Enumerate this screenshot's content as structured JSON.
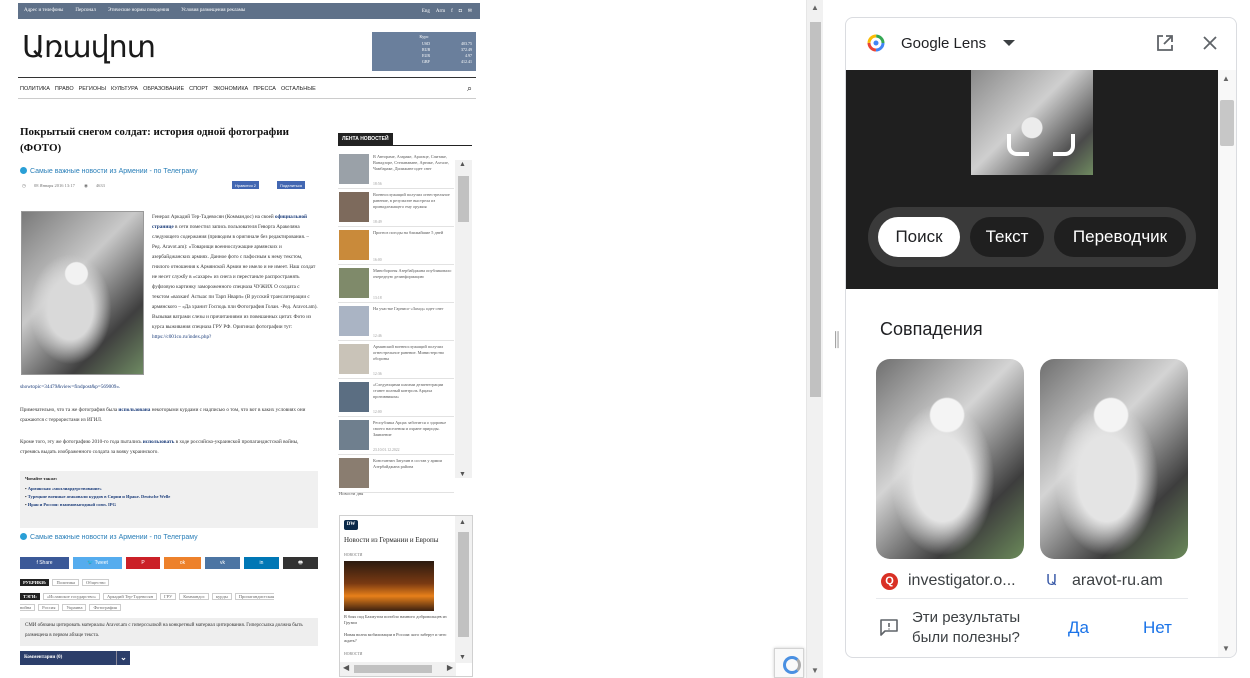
{
  "site": {
    "topbar_left": [
      "Адрес и телефоны",
      "Персонал",
      "Этические нормы поведения",
      "Условия размещения рекламы"
    ],
    "topbar_right": [
      "Eng",
      "Arm",
      "f",
      "◘",
      "✉"
    ],
    "logo": "Առավոտ",
    "rates": {
      "header": "Курс",
      "rows": [
        {
          "cur": "USD",
          "val": "403.75"
        },
        {
          "cur": "RUB",
          "val": "372.49"
        },
        {
          "cur": "EUR",
          "val": "4.97"
        },
        {
          "cur": "GBP",
          "val": "412.41"
        }
      ]
    },
    "nav": [
      "ПОЛИТИКА",
      "ПРАВО",
      "РЕГИОНЫ",
      "КУЛЬТУРА",
      "ОБРАЗОВАНИЕ",
      "СПОРТ",
      "ЭКОНОМИКА",
      "ПРЕССА",
      "ОСТАЛЬНЫЕ"
    ]
  },
  "article": {
    "title": "Покрытый снегом солдат: история одной фотографии (ФОТО)",
    "telegram": "Самые важные новости из Армении - по Телеграму",
    "date": "08 Января 2016 13:17",
    "views": "4633",
    "fb_like": "Нравится 2",
    "fb_share": "Поделиться",
    "p1_a": "Генерал Аркадий Тер-Тадевосян (Коммандос) на своей",
    "p1_link": "официальной странице",
    "p1_b": "в сети поместил запись пользователя Геворга Аракеляна следующего содержания (приводим в оригинале без редактирования. – Ред. Aravot.am): «Товарищи военнослужащие армянских и азербайджанских армиях. Данное фото с пафосным к нему текстом, гнилого отношения к Армянской Армии не имело и не имеет. Наш солдат не несет службу в «сахаре» из снега и перестаньте распространять фуфловую картинку замороженного спецназа ЧУЖИХ О солдата с текстом «вахкан! Астыас пи Тарп Нварп» (В русский транслитерации с армянского – «Да хранит Господь пли Фотография Голан. -Ред. Aravot.am). Вызывая ватрами слезы и причитаниями из повешанных цитат. Фото из курса выживания спецназа ГРУ РФ. Оригинал фотографии тут:",
    "p1_url": "https://c001co.ru/index.php?",
    "p1_tail": "showtopic=34479&view=findpost&p=569009».",
    "p2_a": "Примечательно, что та же фотография была",
    "p2_link": "использована",
    "p2_b": "некоторыми курдами с надписью о том, что вот в каких условиях они сражаются с террористами из ИГИЛ.",
    "p3_a": "Кроме того, эту же фотографию 2010-го года пытались",
    "p3_link": "использовать",
    "p3_b": "в ходе российско-украинской пропагандистской войны, стремясь выдать изображенного солдата за вояку украинского.",
    "read_also": {
      "heading": "Читайте также:",
      "items": [
        "Армянская «миллиардерствование»",
        "Турецкие военные атаковали курдов в Сирии и Ираке. Deutsche Welle",
        "Иран и Россия: взаимовыгодный союз. IPG"
      ]
    },
    "share": [
      "f  Share",
      "🐦  Tweet",
      "P",
      "ok",
      "vk",
      "in",
      "🖶"
    ],
    "rubrics_label": "РУБРИКИ:",
    "rubrics": [
      "Политика",
      "Общество"
    ],
    "tags_label": "ТЭГИ:",
    "tags": [
      "«Исламское государство»",
      "Аркадий Тер-Тадевосян",
      "ГРУ",
      "Коммандос",
      "курды",
      "Пропагандистская война",
      "Россия",
      "Украина",
      "Фотография"
    ],
    "notice": "СМИ обязаны цитировать материалы Aravot.am с гиперссылкой на конкретный материал цитирования. Гиперссылка должна быть размещена в первом абзаце текста.",
    "comments": "Комментарии (0)"
  },
  "feed": {
    "heading": "ЛЕНТА НОВОСТЕЙ",
    "items": [
      {
        "text": "В Автораме, Азараке, Арагаце, Спитаке, Ванадзоре, Степанаване, Артике, Ахтале, Чамбараке, Дилижане идет снег",
        "time": "18:56"
      },
      {
        "text": "Военнослужащий получил огнестрельное ранение, в результате выстрела из принадлежащего ему оружия",
        "time": "18:49"
      },
      {
        "text": "Прогноз погоды на ближайшие 5 дней",
        "time": "16:00"
      },
      {
        "text": "Минобороны Азербайджана опубликовало очередную дезинформацию",
        "time": "13:18"
      },
      {
        "text": "На участке Гарнисо-«Заход» идет снег",
        "time": "12:46"
      },
      {
        "text": "Армянский военнослужащий получил огнестрельное ранение. Министерство обороны",
        "time": "12:36"
      },
      {
        "text": "«Следующими шагами дезинтеграции станет полный контроль Арцаха противником»",
        "time": "12:00"
      },
      {
        "text": "Республика Арцах заботится о здоровье своего населения и охране природы. Заявление",
        "time": "23.10.01.12.2022"
      },
      {
        "text": "Константин Затулин в состав у армии Азербайджана района",
        "time": ""
      }
    ],
    "more": "Новости дня"
  },
  "dw": {
    "logo": "DW",
    "title": "Новости из Германии и Европы",
    "cat1": "НОВОСТИ",
    "item1": "В боях под Бахмутом погибло намного добровольцев из Грузии",
    "item2": "Новая волна мобилизации в России: кого заберут и чего ждать?",
    "cat2": "НОВОСТИ"
  },
  "lens": {
    "title": "Google Lens",
    "tabs": [
      "Поиск",
      "Текст",
      "Переводчик"
    ],
    "matches_heading": "Совпадения",
    "matches": [
      {
        "source": "investigator.o..."
      },
      {
        "source": "aravot-ru.am"
      }
    ],
    "feedback_question": "Эти результаты были полезны?",
    "yes": "Да",
    "no": "Нет"
  }
}
